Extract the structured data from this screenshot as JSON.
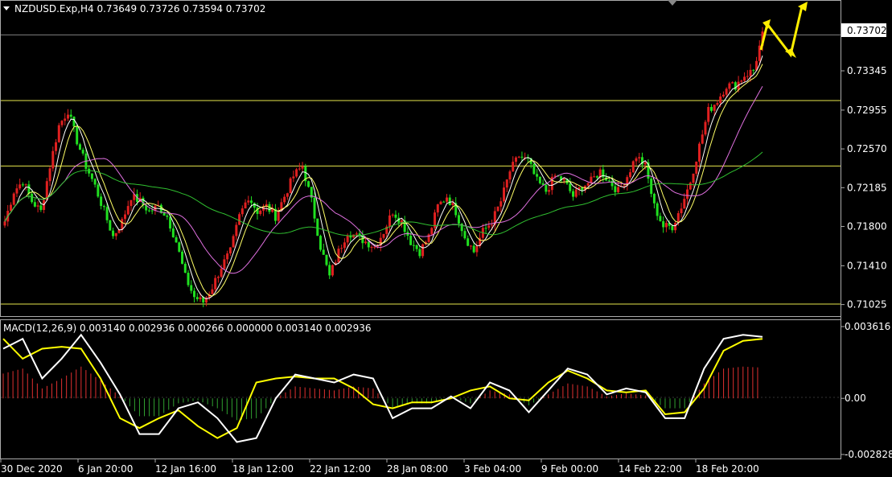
{
  "header": {
    "symbol_line": "NZDUSD.Exp,H4  0.73649 0.73726 0.73594 0.73702",
    "macd_line": "MACD(12,26,9) 0.003140 0.002936 0.000266 0.000000 0.003140 0.002936"
  },
  "price_axis": {
    "ticks": [
      "0.73345",
      "0.72955",
      "0.72570",
      "0.72185",
      "0.71800",
      "0.71410",
      "0.71025"
    ],
    "current_price": "0.73702"
  },
  "macd_axis": {
    "ticks": [
      "0.003616",
      "0.00",
      "-0.002828"
    ]
  },
  "time_axis": {
    "labels": [
      "30 Dec 2020",
      "6 Jan 20:00",
      "12 Jan 16:00",
      "18 Jan 12:00",
      "22 Jan 12:00",
      "28 Jan 08:00",
      "3 Feb 04:00",
      "9 Feb 00:00",
      "14 Feb 22:00",
      "18 Feb 20:00"
    ]
  },
  "colors": {
    "background": "#000000",
    "bull_candle": "#e02020",
    "bear_candle": "#20e020",
    "fast_ma": "#ffffff",
    "mid_ma": "#ffff66",
    "slow_ma": "#e070e0",
    "long_ma": "#30c030",
    "level_line": "#e6e64c",
    "current_line": "#808080",
    "hist_pos": "#e03030",
    "hist_neg": "#30a030",
    "macd_line": "#ffffff",
    "signal_line": "#ffff00",
    "arrow": "#ffee00"
  },
  "chart_data": [
    {
      "type": "candlestick",
      "title": "NZDUSD.Exp,H4",
      "ylim": [
        0.7095,
        0.74
      ],
      "x": [
        "30 Dec 2020",
        "6 Jan 20:00",
        "12 Jan 16:00",
        "18 Jan 12:00",
        "22 Jan 12:00",
        "28 Jan 08:00",
        "3 Feb 04:00",
        "9 Feb 00:00",
        "14 Feb 22:00",
        "18 Feb 20:00"
      ],
      "close_path": [
        0.7185,
        0.7215,
        0.7225,
        0.7205,
        0.7195,
        0.724,
        0.728,
        0.7295,
        0.7265,
        0.724,
        0.722,
        0.7195,
        0.717,
        0.7185,
        0.721,
        0.7205,
        0.7195,
        0.72,
        0.719,
        0.7165,
        0.713,
        0.711,
        0.7105,
        0.712,
        0.714,
        0.7155,
        0.719,
        0.721,
        0.7195,
        0.72,
        0.719,
        0.721,
        0.723,
        0.724,
        0.7205,
        0.716,
        0.713,
        0.7155,
        0.7175,
        0.717,
        0.7165,
        0.716,
        0.7175,
        0.7195,
        0.7185,
        0.7165,
        0.7155,
        0.717,
        0.72,
        0.721,
        0.7195,
        0.717,
        0.7155,
        0.7175,
        0.7185,
        0.7205,
        0.7235,
        0.725,
        0.7245,
        0.7225,
        0.7215,
        0.723,
        0.7225,
        0.721,
        0.722,
        0.7225,
        0.7235,
        0.7225,
        0.7215,
        0.723,
        0.725,
        0.724,
        0.72,
        0.718,
        0.718,
        0.72,
        0.7225,
        0.726,
        0.7295,
        0.7305,
        0.732,
        0.732,
        0.733,
        0.7335,
        0.737
      ],
      "levels": [
        0.73702,
        0.7305,
        0.724,
        0.7103
      ],
      "moving_averages": [
        "fast",
        "mid",
        "slow",
        "long"
      ],
      "annotation": "projected path arrows"
    },
    {
      "type": "line",
      "title": "MACD(12,26,9)",
      "ylim": [
        -0.002828,
        0.003616
      ],
      "series": [
        {
          "name": "MACD",
          "values": [
            0.0025,
            0.003,
            0.001,
            0.002,
            0.0032,
            0.0018,
            0.0002,
            -0.0018,
            -0.0018,
            -0.0005,
            -0.0002,
            -0.001,
            -0.0022,
            -0.002,
            0.0,
            0.0012,
            0.001,
            0.0008,
            0.0012,
            0.001,
            -0.001,
            -0.0005,
            -0.0005,
            0.0001,
            -0.0005,
            0.0008,
            0.0004,
            -0.0007,
            0.0004,
            0.0015,
            0.0012,
            0.0002,
            0.0005,
            0.0003,
            -0.001,
            -0.001,
            0.0015,
            0.003,
            0.0032,
            0.0031
          ]
        },
        {
          "name": "Signal",
          "values": [
            0.003,
            0.002,
            0.0025,
            0.0026,
            0.0025,
            0.001,
            -0.001,
            -0.0015,
            -0.001,
            -0.0006,
            -0.0014,
            -0.002,
            -0.0015,
            0.0008,
            0.001,
            0.0011,
            0.001,
            0.001,
            0.0005,
            -0.0003,
            -0.0005,
            -0.0002,
            -0.0002,
            0.0,
            0.0004,
            0.0006,
            0.0,
            -0.0001,
            0.0008,
            0.0014,
            0.001,
            0.0004,
            0.0003,
            0.0004,
            -0.0008,
            -0.0007,
            0.0005,
            0.0024,
            0.0029,
            0.003
          ]
        }
      ]
    }
  ]
}
